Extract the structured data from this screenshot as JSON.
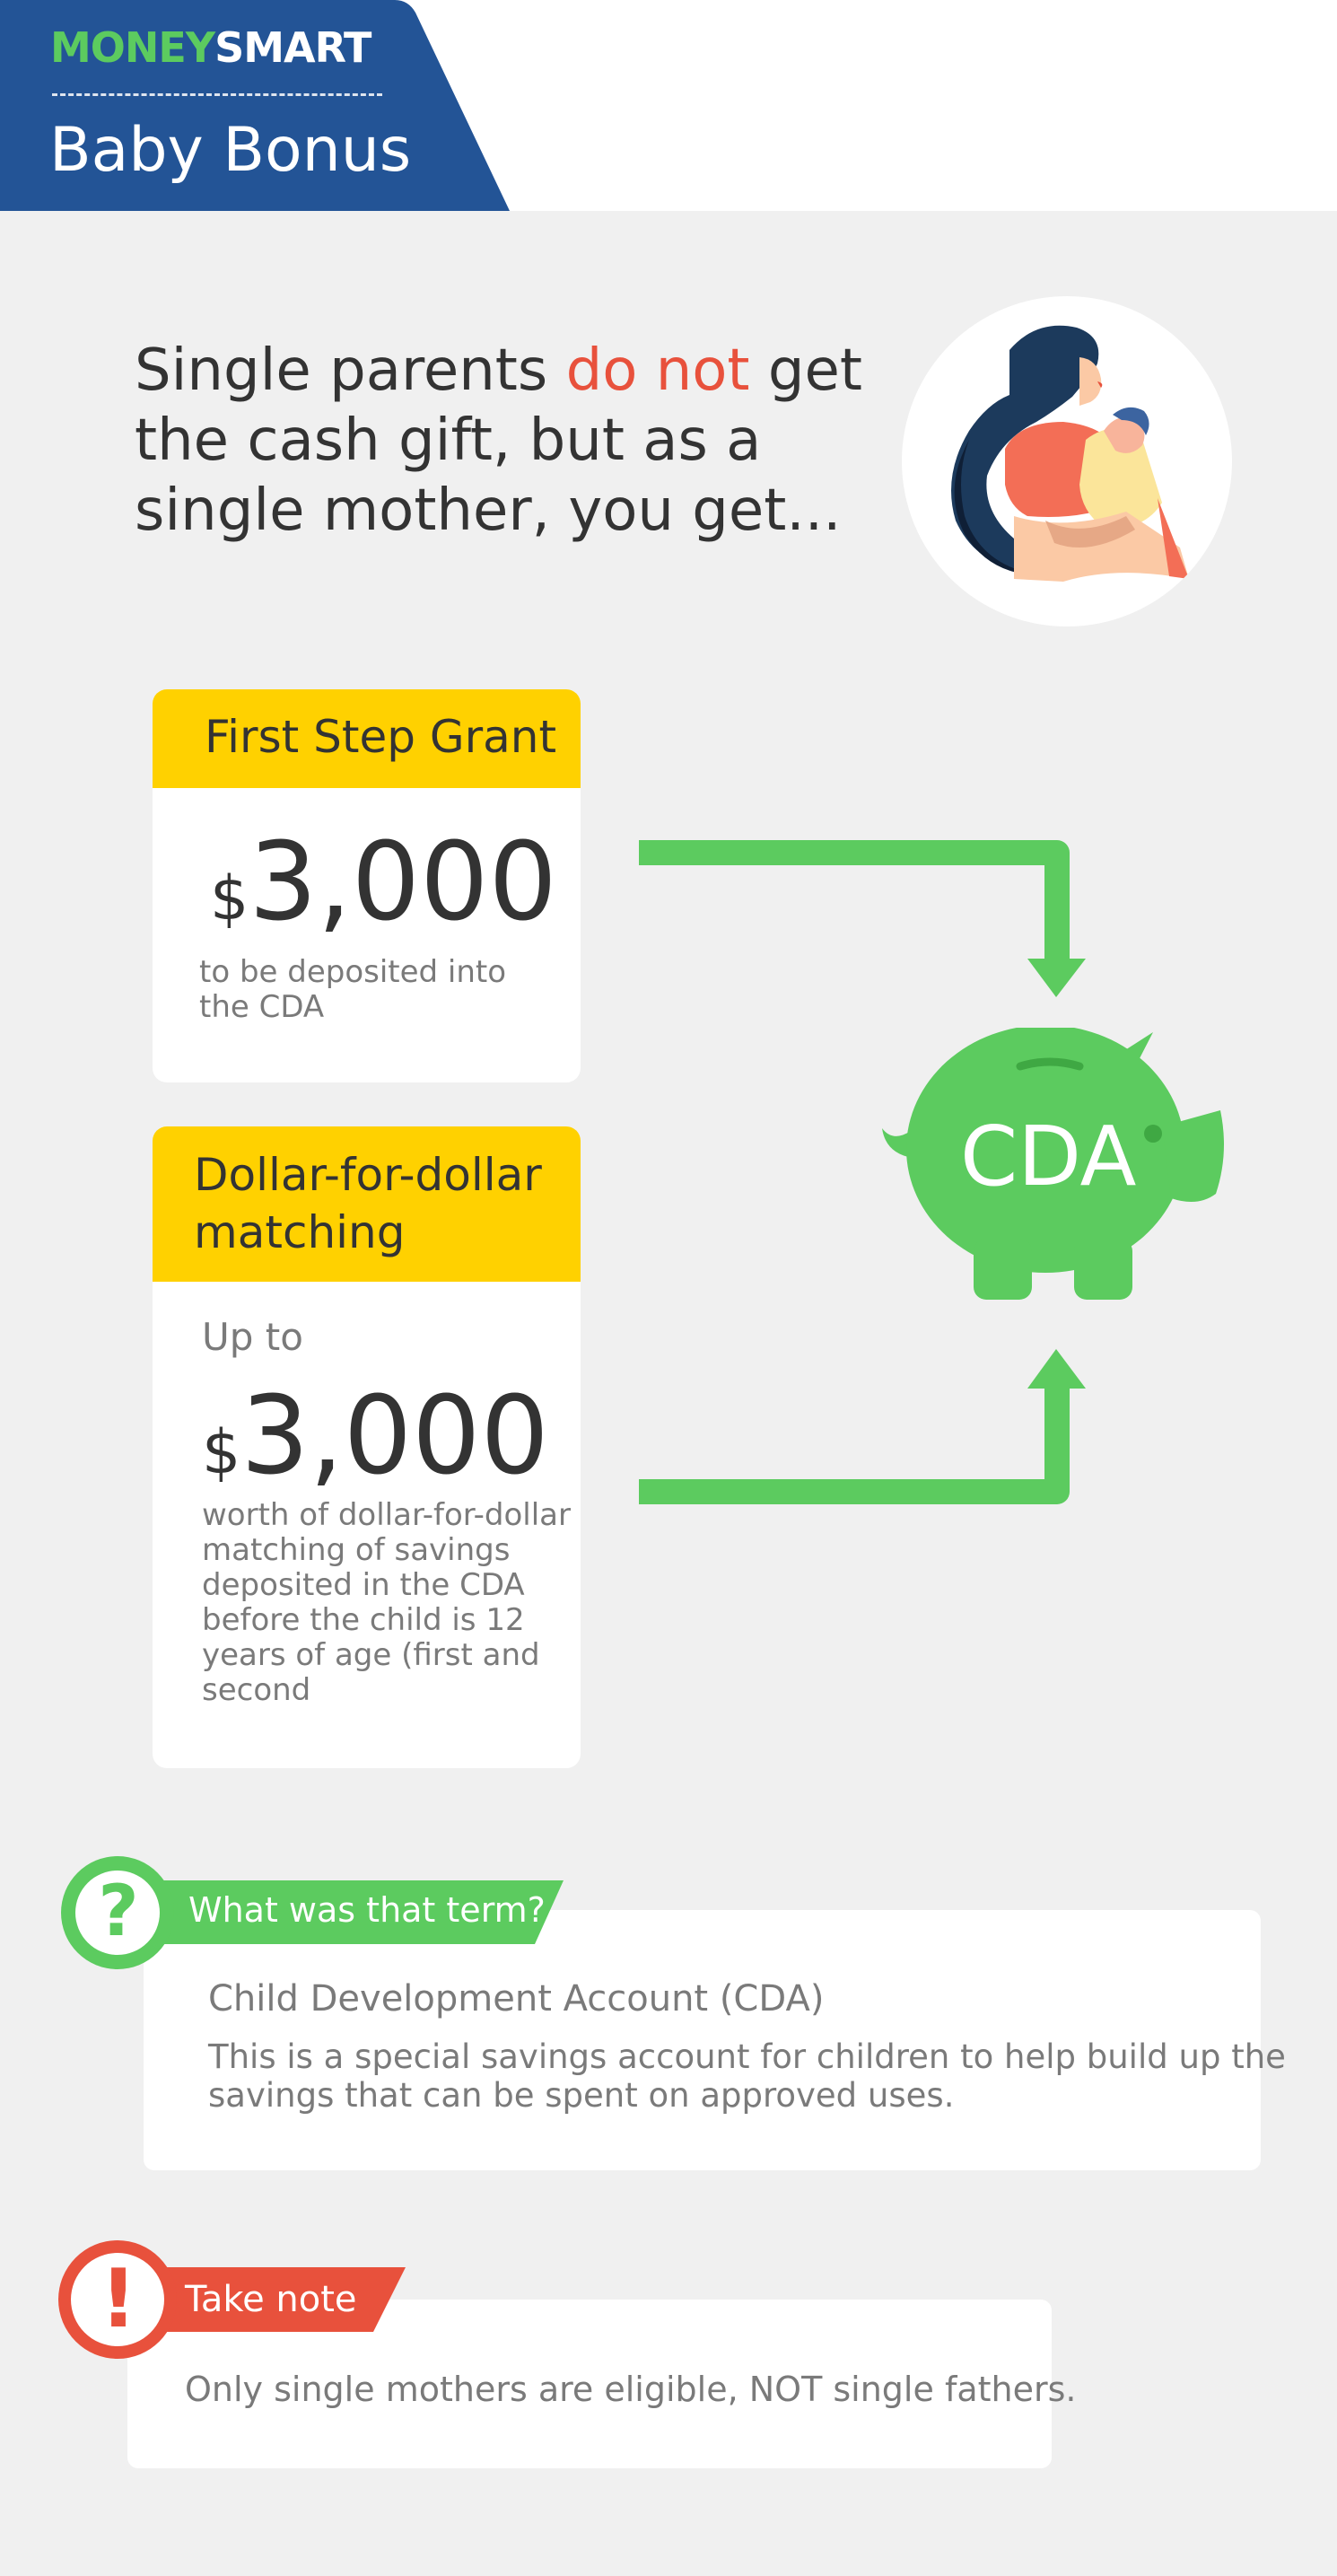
{
  "header": {
    "logo_money": "MONEY",
    "logo_smart": "SMART",
    "title": "Baby Bonus",
    "colors": {
      "header_blue": "#235496",
      "logo_green": "#5ccb5f"
    }
  },
  "headline": {
    "part1": "Single parents ",
    "highlight": "do not",
    "part2": " get the cash gift, but as a single mother, you get...",
    "highlight_color": "#e8513c"
  },
  "illustration": {
    "icon": "mother-holding-baby-icon"
  },
  "first_step_grant": {
    "title": "First Step Grant",
    "currency": "$",
    "amount": "3,000",
    "description": "to be deposited into the CDA"
  },
  "matching": {
    "title": "Dollar-for-dollar matching",
    "up_to": "Up to",
    "currency": "$",
    "amount": "3,000",
    "description": "worth of dollar-for-dollar matching of savings deposited in the CDA before the child is 12 years of age (first and second"
  },
  "piggy_bank": {
    "label": "CDA",
    "icon": "piggy-bank-icon",
    "color": "#5ccb5f"
  },
  "term": {
    "banner": "What was that term?",
    "icon": "question-mark-icon",
    "title": "Child Development Account (CDA)",
    "description": "This is a special savings account for children to help build up the savings that can be spent on approved uses."
  },
  "note": {
    "banner": "Take note",
    "icon": "exclamation-icon",
    "text": "Only single mothers are eligible, NOT single fathers.",
    "color": "#e8513c"
  }
}
